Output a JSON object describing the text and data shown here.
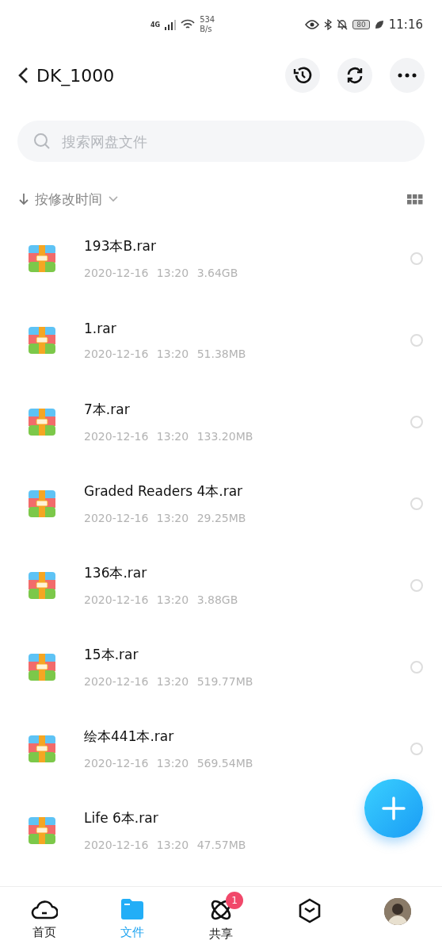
{
  "status_bar": {
    "network": "4G",
    "speed_value": "534",
    "speed_unit": "B/s",
    "battery": "80",
    "time": "11:16"
  },
  "header": {
    "title": "DK_1000"
  },
  "search": {
    "placeholder": "搜索网盘文件"
  },
  "sort": {
    "label": "按修改时间"
  },
  "files": [
    {
      "name": "193本B.rar",
      "date": "2020-12-16",
      "time": "13:20",
      "size": "3.64GB",
      "selected": false
    },
    {
      "name": "1.rar",
      "date": "2020-12-16",
      "time": "13:20",
      "size": "51.38MB",
      "selected": false
    },
    {
      "name": "7本.rar",
      "date": "2020-12-16",
      "time": "13:20",
      "size": "133.20MB",
      "selected": false
    },
    {
      "name": "Graded Readers 4本.rar",
      "date": "2020-12-16",
      "time": "13:20",
      "size": "29.25MB",
      "selected": false
    },
    {
      "name": "136本.rar",
      "date": "2020-12-16",
      "time": "13:20",
      "size": "3.88GB",
      "selected": false
    },
    {
      "name": "15本.rar",
      "date": "2020-12-16",
      "time": "13:20",
      "size": "519.77MB",
      "selected": false
    },
    {
      "name": "绘本441本.rar",
      "date": "2020-12-16",
      "time": "13:20",
      "size": "569.54MB",
      "selected": false
    },
    {
      "name": "Life 6本.rar",
      "date": "2020-12-16",
      "time": "13:20",
      "size": "47.57MB"
    }
  ],
  "nav": [
    {
      "kind": "home",
      "label": "首页",
      "selected": false
    },
    {
      "kind": "files",
      "label": "文件",
      "selected": true
    },
    {
      "kind": "share",
      "label": "共享",
      "selected": false,
      "badge": "1"
    },
    {
      "kind": "discover",
      "selected": false
    },
    {
      "kind": "avatar",
      "selected": false
    }
  ]
}
